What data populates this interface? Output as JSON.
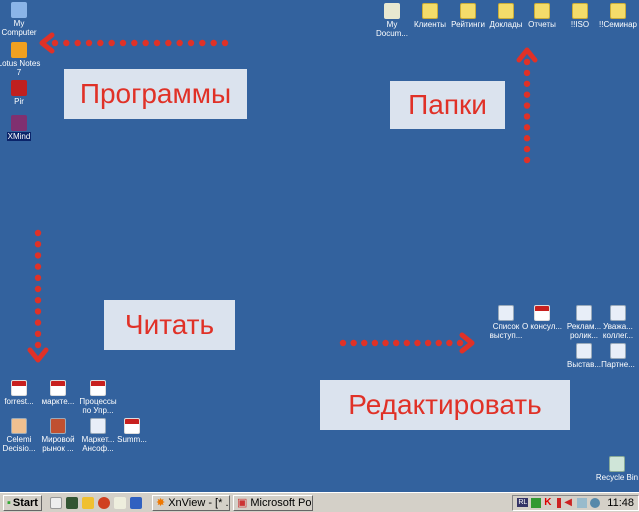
{
  "desktop_icons_left": [
    {
      "label": "My Computer",
      "icon": "computer-icon"
    },
    {
      "label": "Lotus Notes 7",
      "icon": "lotus-notes-icon"
    },
    {
      "label": "Pir",
      "icon": "pir-icon"
    },
    {
      "label": "XMind",
      "icon": "xmind-icon"
    }
  ],
  "desktop_icons_top": [
    {
      "label": "My Docum...",
      "icon": "my-documents-icon"
    },
    {
      "label": "Клиенты",
      "icon": "folder-icon"
    },
    {
      "label": "Рейтинги",
      "icon": "folder-icon"
    },
    {
      "label": "Доклады",
      "icon": "folder-icon"
    },
    {
      "label": "Отчеты",
      "icon": "folder-icon"
    },
    {
      "label": "!!ISO",
      "icon": "folder-icon"
    },
    {
      "label": "!!Семинар",
      "icon": "folder-icon"
    }
  ],
  "read_icons": [
    {
      "label": "forrest...",
      "icon": "pdf-icon"
    },
    {
      "label": "маркте...",
      "icon": "pdf-icon"
    },
    {
      "label": "Процессы по Упр...",
      "icon": "pdf-icon"
    },
    {
      "label": "Celemi Decisio...",
      "icon": "powerpoint-icon"
    },
    {
      "label": "Мировой рынок ...",
      "icon": "image-icon"
    },
    {
      "label": "Маркет... Ансоф...",
      "icon": "word-icon"
    },
    {
      "label": "Summ...",
      "icon": "pdf-icon"
    }
  ],
  "edit_icons": [
    {
      "label": "Список выступ...",
      "icon": "word-icon"
    },
    {
      "label": "О консул...",
      "icon": "pdf-icon"
    },
    {
      "label": "Реклам... ролик...",
      "icon": "word-icon"
    },
    {
      "label": "Уважа... коллег...",
      "icon": "word-icon"
    },
    {
      "label": "Выстав...",
      "icon": "word-icon"
    },
    {
      "label": "Партне...",
      "icon": "word-icon"
    }
  ],
  "recycle_bin": {
    "label": "Recycle Bin"
  },
  "callouts": {
    "programs": "Программы",
    "folders": "Папки",
    "read": "Читать",
    "edit": "Редактировать"
  },
  "taskbar": {
    "start": "Start",
    "tasks": [
      "XnView - [* ...",
      "Microsoft Po..."
    ],
    "clock": "11:48",
    "tray_lang": "RL"
  },
  "colors": {
    "desktop": "#33629e",
    "callout_text": "#e03127",
    "arrow": "#e03127"
  }
}
